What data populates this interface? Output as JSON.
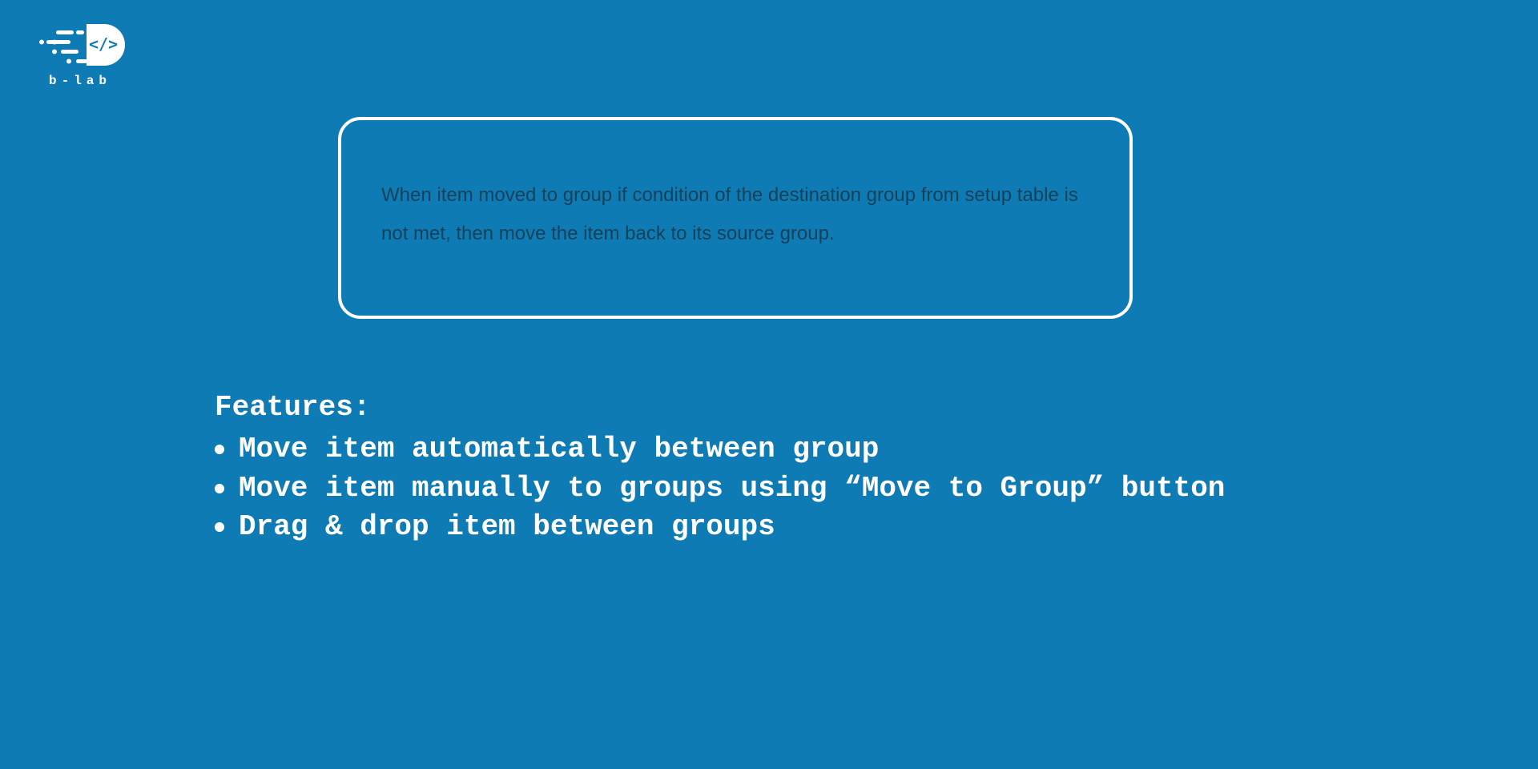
{
  "logo": {
    "name": "b-lab"
  },
  "card": {
    "description": "When item moved to group if condition of the destination group from setup table is not met, then move the item back to its source group."
  },
  "features": {
    "heading": "Features:",
    "items": [
      "Move item automatically between group",
      "Move item manually to groups using “Move to Group” button",
      "Drag & drop item between groups"
    ]
  }
}
